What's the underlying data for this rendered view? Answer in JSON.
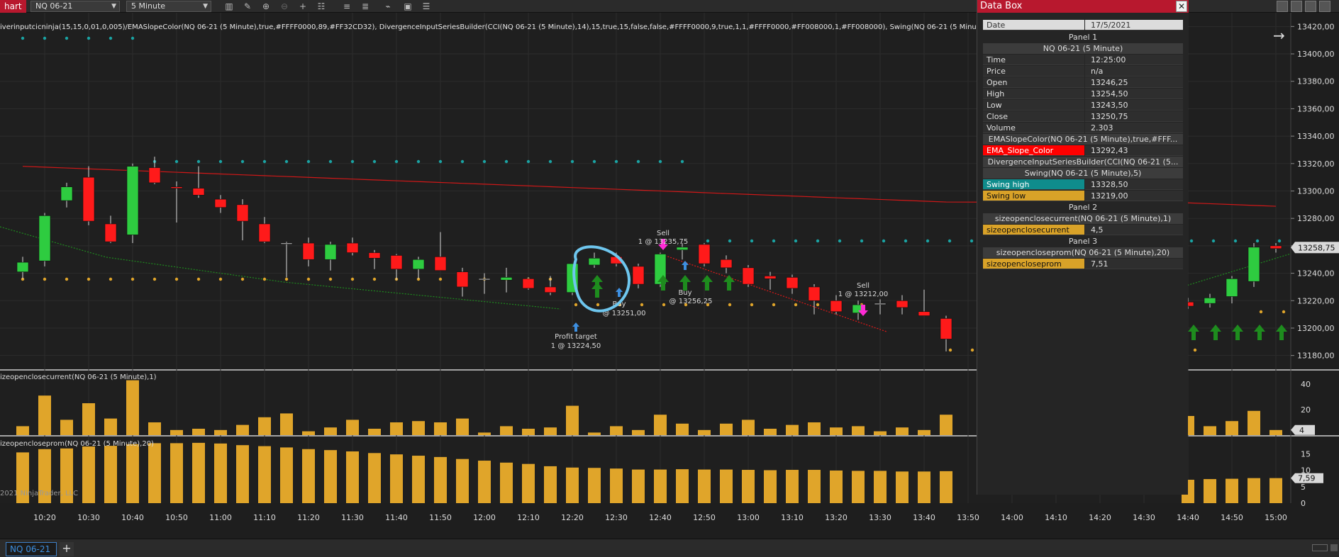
{
  "window": {
    "tab_title": "hart"
  },
  "toolbar": {
    "instrument": "NQ 06-21",
    "interval": "5 Minute",
    "tools": [
      "bar-chart-icon",
      "pencil-icon",
      "zoom-in-icon",
      "zoom-out-icon",
      "crosshair-icon",
      "properties-icon",
      "strategies-icon",
      "indicators-icon",
      "chart-trader-icon",
      "data-box-icon",
      "more-icon"
    ]
  },
  "chart": {
    "indicator_line": "iverinputcicninja(15,15,0,01,0,005)/EMASlopeColor(NQ 06-21 (5 Minute),true,#FFFF0000,89,#FF32CD32), DivergenceInputSeriesBuilder(CCI(NQ 06-21 (5 Minute),14),15,true,15,false,false,#FFFF0000,9,true,1,1,#FFFF0000,#FF008000,1,#FF008000), Swing(NQ 06-21 (5 Minute),5)",
    "panel2_label": "izeopenclosecurrent(NQ 06-21 (5 Minute),1)",
    "panel3_label": "izeopencloseprom(NQ 06-21 (5 Minute),20)",
    "copyright": "2021 NinjaTrader, LLC",
    "price_axis": [
      "13420,00",
      "13400,00",
      "13380,00",
      "13360,00",
      "13340,00",
      "13320,00",
      "13300,00",
      "13280,00",
      "13260,00",
      "13240,00",
      "13220,00",
      "13200,00",
      "13180,00"
    ],
    "price_marker": "13258,75",
    "panel2_axis": [
      "40",
      "20"
    ],
    "panel2_marker": "4",
    "panel3_axis": [
      "15",
      "10",
      "5",
      "0"
    ],
    "panel3_marker": "7,59",
    "time_axis": [
      "10:20",
      "10:30",
      "10:40",
      "10:50",
      "11:00",
      "11:10",
      "11:20",
      "11:30",
      "11:40",
      "11:50",
      "12:00",
      "12:10",
      "12:20",
      "12:30",
      "12:40",
      "12:50",
      "13:00",
      "13:10",
      "13:20",
      "13:30",
      "13:40",
      "13:50",
      "14:00",
      "14:10",
      "14:20",
      "14:30",
      "14:40",
      "14:50",
      "15:00"
    ],
    "annotations": {
      "profit_target": [
        "Profit target",
        "1 @ 13224,50"
      ],
      "buy1": [
        "Buy",
        "@ 13251,00"
      ],
      "sell1": [
        "Sell",
        "1 @ 13235,75"
      ],
      "buy2": [
        "Buy",
        "@ 13256,25"
      ],
      "sell2": [
        "Sell",
        "1 @ 13212,00"
      ]
    },
    "colors": {
      "bull": "#2ecc40",
      "bear": "#ff1a1a",
      "ema": "#d01818",
      "swing_high": "#1aa3a3",
      "swing_low": "#e0a52a",
      "bars": "#e0a52a",
      "arrow_up": "#1e8c1e",
      "arrow_down": "#ff2bd6",
      "highlight": "#6ec6ee"
    }
  },
  "databox": {
    "title": "Data Box",
    "date_label": "Date",
    "date_value": "17/5/2021",
    "panel1": "Panel 1",
    "instrument": "NQ 06-21 (5 Minute)",
    "rows": [
      {
        "k": "Time",
        "v": "12:25:00"
      },
      {
        "k": "Price",
        "v": "n/a"
      },
      {
        "k": "Open",
        "v": "13246,25"
      },
      {
        "k": "High",
        "v": "13254,50"
      },
      {
        "k": "Low",
        "v": "13243,50"
      },
      {
        "k": "Close",
        "v": "13250,75"
      },
      {
        "k": "Volume",
        "v": "2.303"
      }
    ],
    "ema_head": "EMASlopeColor(NQ 06-21 (5 Minute),true,#FFF...",
    "ema_row": {
      "k": "EMA_Slope_Color",
      "v": "13292,43"
    },
    "div_head": "DivergenceInputSeriesBuilder(CCI(NQ 06-21 (5...",
    "swing_head": "Swing(NQ 06-21 (5 Minute),5)",
    "swing_high": {
      "k": "Swing high",
      "v": "13328,50"
    },
    "swing_low": {
      "k": "Swing low",
      "v": "13219,00"
    },
    "panel2": "Panel 2",
    "p2_head": "sizeopenclosecurrent(NQ 06-21 (5 Minute),1)",
    "p2_row": {
      "k": "sizeopenclosecurrent",
      "v": "4,5"
    },
    "panel3": "Panel 3",
    "p3_head": "sizeopencloseprom(NQ 06-21 (5 Minute),20)",
    "p3_row": {
      "k": "sizeopencloseprom",
      "v": "7,51"
    }
  },
  "bottom": {
    "tab": "NQ 06-21",
    "add": "+"
  },
  "chart_data": {
    "type": "candlestick",
    "times": [
      "10:15",
      "10:20",
      "10:25",
      "10:30",
      "10:35",
      "10:40",
      "10:45",
      "10:50",
      "10:55",
      "11:00",
      "11:05",
      "11:10",
      "11:15",
      "11:20",
      "11:25",
      "11:30",
      "11:35",
      "11:40",
      "11:45",
      "11:50",
      "11:55",
      "12:00",
      "12:05",
      "12:10",
      "12:15",
      "12:20",
      "12:25",
      "12:30",
      "12:35",
      "12:40",
      "12:45",
      "12:50",
      "12:55",
      "13:00",
      "13:05",
      "13:10",
      "13:15",
      "13:20",
      "13:25",
      "13:30",
      "13:35",
      "13:40",
      "13:45",
      "14:40",
      "14:45",
      "14:50",
      "14:55",
      "15:00"
    ],
    "ohlc": [
      [
        13241,
        13252,
        13236,
        13248
      ],
      [
        13249,
        13284,
        13245,
        13282
      ],
      [
        13293,
        13306,
        13288,
        13303
      ],
      [
        13310,
        13318,
        13275,
        13278
      ],
      [
        13276,
        13282,
        13262,
        13263
      ],
      [
        13268,
        13320,
        13262,
        13318
      ],
      [
        13317,
        13325,
        13305,
        13306
      ],
      [
        13303,
        13307,
        13277,
        13302
      ],
      [
        13302,
        13318,
        13295,
        13297
      ],
      [
        13294,
        13297,
        13284,
        13288
      ],
      [
        13290,
        13294,
        13264,
        13278
      ],
      [
        13276,
        13281,
        13262,
        13263
      ],
      [
        13262,
        13263,
        13237,
        13262
      ],
      [
        13262,
        13266,
        13245,
        13250
      ],
      [
        13250,
        13263,
        13242,
        13261
      ],
      [
        13262,
        13266,
        13253,
        13255
      ],
      [
        13255,
        13257,
        13243,
        13251
      ],
      [
        13253,
        13254,
        13235,
        13243
      ],
      [
        13243,
        13252,
        13236,
        13250
      ],
      [
        13252,
        13270,
        13243,
        13242
      ],
      [
        13241,
        13244,
        13223,
        13230
      ],
      [
        13236,
        13240,
        13225,
        13236
      ],
      [
        13235,
        13244,
        13226,
        13237
      ],
      [
        13236,
        13237,
        13228,
        13229
      ],
      [
        13230,
        13238,
        13224,
        13226
      ],
      [
        13226,
        13247,
        13224,
        13247
      ],
      [
        13246,
        13255,
        13244,
        13251
      ],
      [
        13252,
        13255,
        13245,
        13247
      ],
      [
        13245,
        13247,
        13229,
        13232
      ],
      [
        13232,
        13255,
        13230,
        13254
      ],
      [
        13257,
        13262,
        13250,
        13259
      ],
      [
        13261,
        13262,
        13245,
        13247
      ],
      [
        13250,
        13253,
        13240,
        13244
      ],
      [
        13244,
        13246,
        13230,
        13232
      ],
      [
        13238,
        13241,
        13228,
        13236
      ],
      [
        13237,
        13239,
        13225,
        13229
      ],
      [
        13230,
        13232,
        13210,
        13220
      ],
      [
        13220,
        13224,
        13210,
        13212
      ],
      [
        13211,
        13220,
        13206,
        13217
      ],
      [
        13218,
        13221,
        13210,
        13218
      ],
      [
        13220,
        13224,
        13210,
        13215
      ],
      [
        13212,
        13228,
        13210,
        13209
      ],
      [
        13207,
        13209,
        13183,
        13192
      ],
      [
        13219,
        13222,
        13214,
        13216
      ],
      [
        13218,
        13225,
        13215,
        13222
      ],
      [
        13223,
        13238,
        13218,
        13236
      ],
      [
        13234,
        13262,
        13230,
        13259
      ],
      [
        13260,
        13262,
        13255,
        13258
      ]
    ],
    "sizeopenclosecurrent": [
      7,
      31,
      12,
      25,
      13,
      43,
      10,
      4,
      5,
      4,
      8,
      14,
      17,
      3,
      6,
      12,
      5,
      10,
      11,
      10,
      13,
      2,
      7,
      5,
      6,
      23,
      2,
      7,
      4,
      16,
      9,
      4,
      9,
      12,
      5,
      8,
      10,
      6,
      7,
      3,
      6,
      4,
      16,
      15,
      7,
      11,
      19,
      4
    ],
    "sizeopencloseprom": [
      15.4,
      16.4,
      16.6,
      17.2,
      17.4,
      17.9,
      18.2,
      18.2,
      18.3,
      18.1,
      17.6,
      17.3,
      16.9,
      16.4,
      16.1,
      15.7,
      15.2,
      14.8,
      14.4,
      14.0,
      13.4,
      12.9,
      12.3,
      11.9,
      11.2,
      10.8,
      10.7,
      10.5,
      10.2,
      10.2,
      10.3,
      10.2,
      10.2,
      10.1,
      10.0,
      10.1,
      10.1,
      9.9,
      9.8,
      9.8,
      9.6,
      9.6,
      9.7,
      7.1,
      7.3,
      7.4,
      7.6,
      7.6
    ],
    "price_ylim": [
      13170,
      13430
    ]
  }
}
